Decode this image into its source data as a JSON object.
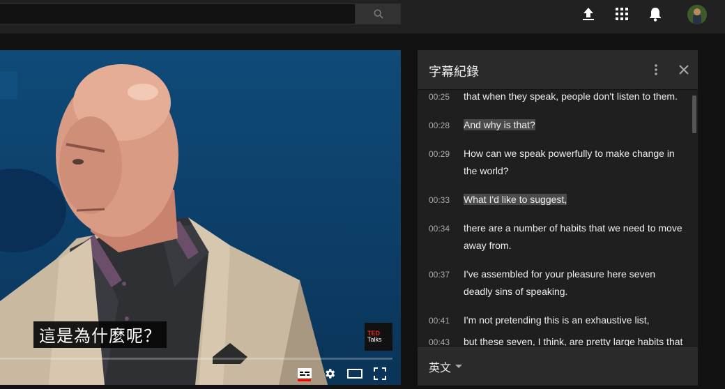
{
  "topbar": {
    "icons": [
      "search-icon",
      "upload-icon",
      "apps-grid-icon",
      "notifications-bell-icon",
      "avatar"
    ]
  },
  "player": {
    "caption": "這是為什麼呢？",
    "logo": {
      "line1": "TED",
      "line2": "Talks"
    },
    "controls": [
      "subtitles-icon",
      "settings-gear-icon",
      "theater-mode-icon",
      "fullscreen-icon"
    ],
    "progress_fraction": 0.0
  },
  "transcript": {
    "title": "字幕紀錄",
    "language": "英文",
    "cues": [
      {
        "time": "00:25",
        "lines": [
          "that when they speak, people don't listen to them."
        ],
        "highlight": false
      },
      {
        "time": "00:28",
        "lines": [
          "And why is that?"
        ],
        "highlight": true
      },
      {
        "time": "00:29",
        "lines": [
          "How can we speak powerfully to make change in",
          "the world?"
        ],
        "highlight": false
      },
      {
        "time": "00:33",
        "lines": [
          "What I'd like to suggest,"
        ],
        "highlight": true
      },
      {
        "time": "00:34",
        "lines": [
          "there are a number of habits that we need to move",
          "away from."
        ],
        "highlight": false
      },
      {
        "time": "00:37",
        "lines": [
          "I've assembled for your pleasure here seven",
          "deadly sins of speaking."
        ],
        "highlight": false
      },
      {
        "time": "00:41",
        "lines": [
          "I'm not pretending this is an exhaustive list,"
        ],
        "highlight": false
      },
      {
        "time": "00:43",
        "lines": [
          "but these seven, I think, are pretty large habits that"
        ],
        "highlight": false
      }
    ]
  }
}
